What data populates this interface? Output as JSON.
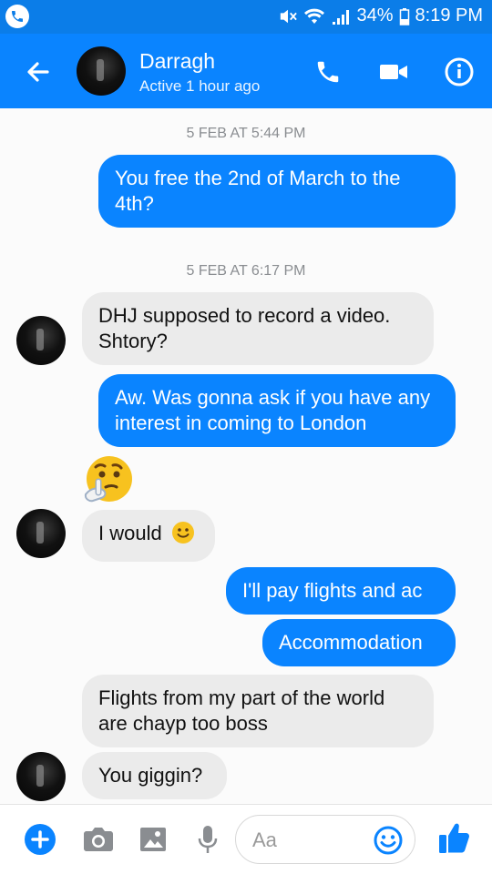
{
  "status_bar": {
    "battery": "34%",
    "time": "8:19 PM"
  },
  "header": {
    "name": "Darragh",
    "status": "Active 1 hour ago"
  },
  "messages": {
    "ts1": "5 FEB AT 5:44 PM",
    "m1": "You free the 2nd of March to the 4th?",
    "ts2": "5 FEB AT 6:17 PM",
    "m2": "DHJ supposed to record a video. Shtory?",
    "m3": "Aw. Was gonna ask if you have any interest in coming to London",
    "m4": "I would",
    "m5": "I'll pay flights and ac",
    "m6": "Accommodation",
    "m7": "Flights from my part of the world are chayp too boss",
    "m8": "You giggin?"
  },
  "composer": {
    "placeholder": "Aa"
  },
  "colors": {
    "accent": "#0a84ff",
    "bubble_in": "#ebebeb"
  }
}
